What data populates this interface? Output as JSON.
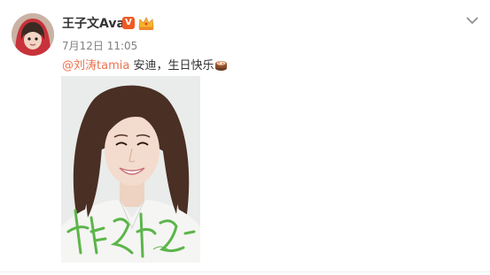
{
  "post": {
    "author": "王子文Ava",
    "verified_badge": "V",
    "timestamp": "7月12日 11:05",
    "mention": "@刘涛tamia",
    "message": " 安迪，生日快乐",
    "cake_emoji": "cake-icon"
  },
  "icons": {
    "menu": "chevron-down-icon",
    "vip": "crown-icon"
  },
  "colors": {
    "mention": "#eb7350",
    "verified": "#f05a23",
    "text": "#333333",
    "meta": "#808080"
  }
}
